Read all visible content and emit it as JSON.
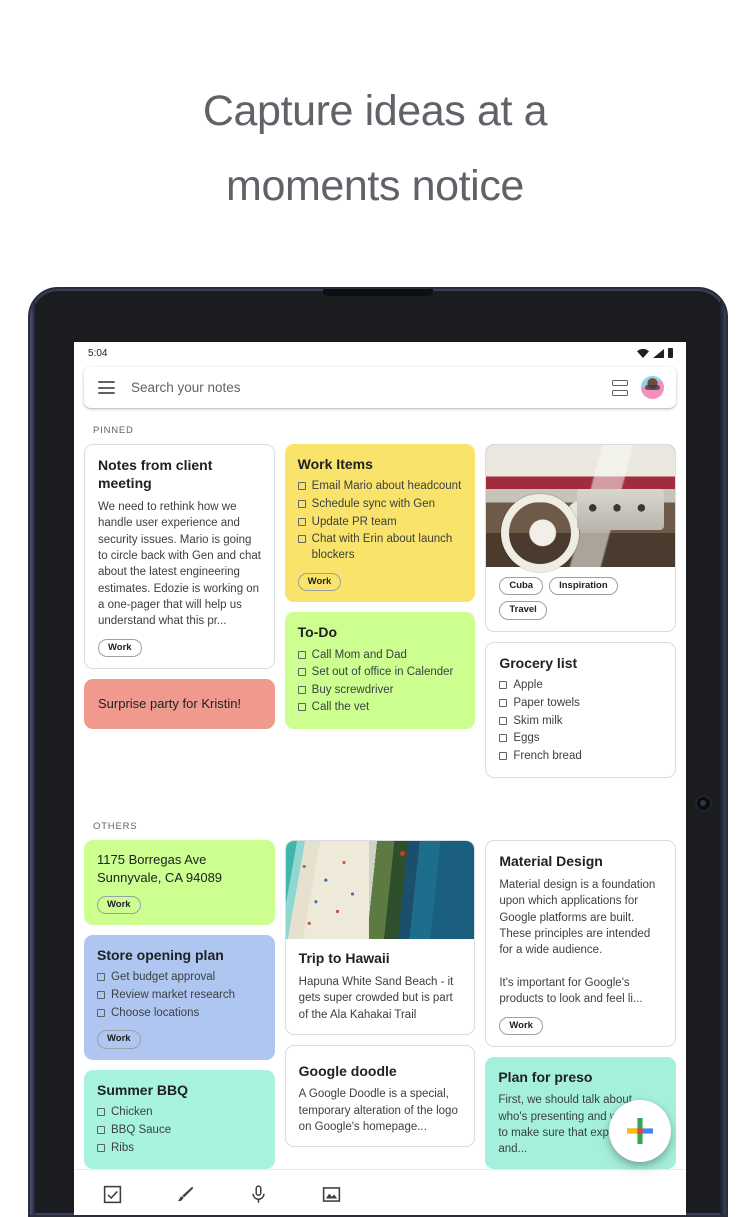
{
  "headline": {
    "line1": "Capture ideas at a",
    "line2": "moments notice"
  },
  "statusbar": {
    "time": "5:04",
    "icons": [
      "wifi-icon",
      "signal-icon",
      "battery-icon"
    ]
  },
  "search": {
    "menu_icon": "hamburger-menu-icon",
    "placeholder": "Search your notes",
    "value": "",
    "view_toggle_icon": "list-view-toggle-icon",
    "avatar": "user-avatar"
  },
  "sections": {
    "pinned_label": "PINNED",
    "others_label": "OTHERS"
  },
  "colors": {
    "yellow": "#FAE36B",
    "green": "#CCFF90",
    "light_green": "#CCFF90",
    "blue": "#AEC6F0",
    "mint": "#A7F3DE",
    "teal": "#A4F0DC",
    "salmon": "#EF9A8D",
    "white": "#FFFFFF",
    "accent_blue": "#4285F4",
    "accent_red": "#EA4335",
    "accent_yellow": "#FBBC05",
    "accent_green": "#34A853"
  },
  "pinned_notes": {
    "client_meeting": {
      "title": "Notes from client meeting",
      "body": "We need to rethink how we handle user experience and security issues. Mario is going to circle back with Gen and chat about the latest engineering estimates. Edozie is working on a one-pager that will help us understand what this pr...",
      "tags": [
        "Work"
      ]
    },
    "surprise_party": {
      "title": "Surprise party for Kristin!"
    },
    "work_items": {
      "title": "Work Items",
      "items": [
        "Email Mario about headcount",
        "Schedule sync with Gen",
        "Update PR team",
        "Chat with Erin about launch blockers"
      ],
      "tags": [
        "Work"
      ]
    },
    "todo": {
      "title": "To-Do",
      "items": [
        "Call Mom and Dad",
        "Set out of office in Calender",
        "Buy screwdriver",
        "Call the vet"
      ]
    },
    "car_photo": {
      "image_name": "vintage-car-interior-photo",
      "tags": [
        "Cuba",
        "Inspiration",
        "Travel"
      ]
    },
    "grocery": {
      "title": "Grocery list",
      "items": [
        "Apple",
        "Paper towels",
        "Skim milk",
        "Eggs",
        "French bread"
      ]
    }
  },
  "other_notes": {
    "address": {
      "title": "1175 Borregas Ave Sunnyvale, CA 94089",
      "tags": [
        "Work"
      ]
    },
    "store_opening": {
      "title": "Store opening plan",
      "items": [
        "Get budget approval",
        "Review market research",
        "Choose locations"
      ],
      "tags": [
        "Work"
      ]
    },
    "summer_bbq": {
      "title": "Summer BBQ",
      "items": [
        "Chicken",
        "BBQ Sauce",
        "Ribs"
      ]
    },
    "hawaii": {
      "image_name": "hawaii-beach-aerial-photos",
      "title": "Trip to Hawaii",
      "body": "Hapuna White Sand Beach - it gets super crowded but is part of the Ala Kahakai Trail"
    },
    "google_doodle": {
      "title": "Google doodle",
      "body": "A Google Doodle is a special, temporary alteration of the logo on Google's homepage..."
    },
    "material_design": {
      "title": "Material Design",
      "body": "Material design is a foundation upon which applications for Google platforms are built. These principles are intended for a wide audience.\n\nIt's important for Google's products to look and feel li...",
      "tags": [
        "Work"
      ]
    },
    "plan_preso": {
      "title": "Plan for preso",
      "body": "First, we should talk about who's presenting and we want to make sure that experiments and..."
    }
  },
  "fab": {
    "label": "create-note",
    "icon": "plus-icon"
  },
  "bottom_toolbar": {
    "tools": [
      "checkbox-icon",
      "brush-icon",
      "microphone-icon",
      "image-icon"
    ]
  }
}
